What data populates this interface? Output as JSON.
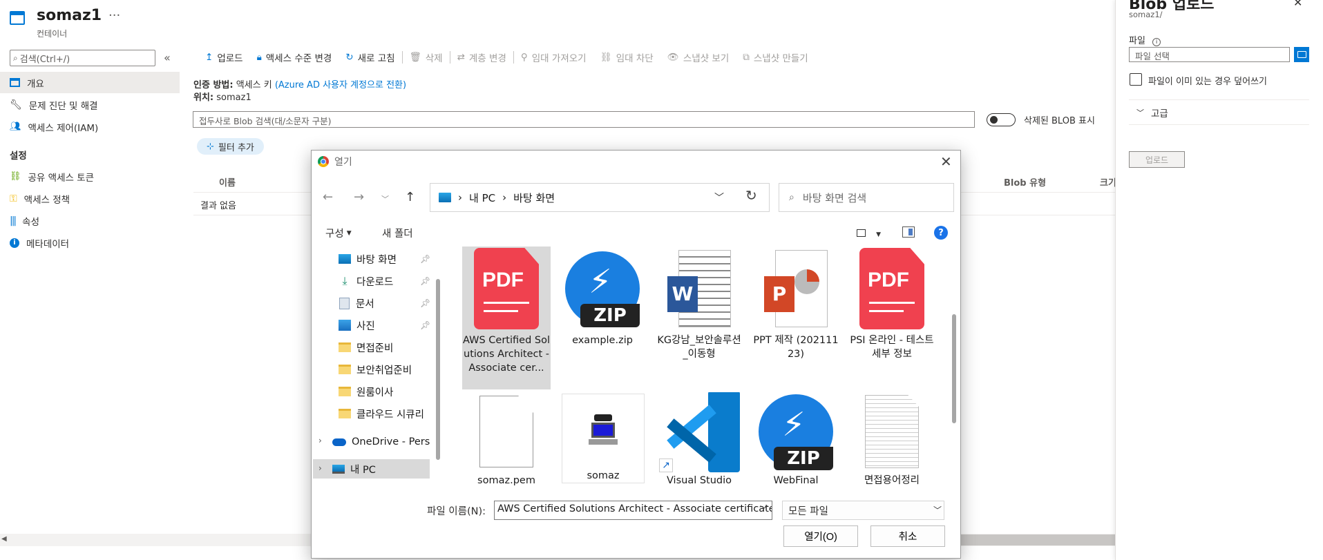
{
  "header": {
    "title": "somaz1",
    "more": "···",
    "subtitle": "컨테이너"
  },
  "sidebar": {
    "search_placeholder": "검색(Ctrl+/)",
    "collapse": "«",
    "items": [
      {
        "label": "개요",
        "icon": "overview-icon"
      },
      {
        "label": "문제 진단 및 해결",
        "icon": "wrench-icon"
      },
      {
        "label": "액세스 제어(IAM)",
        "icon": "people-icon"
      }
    ],
    "section_settings": "설정",
    "settings_items": [
      {
        "label": "공유 액세스 토큰",
        "icon": "link-icon"
      },
      {
        "label": "액세스 정책",
        "icon": "key-icon"
      },
      {
        "label": "속성",
        "icon": "properties-icon"
      },
      {
        "label": "메타데이터",
        "icon": "info-icon"
      }
    ]
  },
  "toolbar": {
    "upload": "업로드",
    "access_level": "액세스 수준 변경",
    "refresh": "새로 고침",
    "delete": "삭제",
    "change_tier": "계층 변경",
    "acquire_lease": "임대 가져오기",
    "break_lease": "임대 차단",
    "view_snapshots": "스냅샷 보기",
    "create_snapshot": "스냅샷 만들기"
  },
  "main": {
    "auth_label": "인증 방법:",
    "auth_value": "액세스 키",
    "auth_link": "(Azure AD 사용자 계정으로 전환)",
    "location_label": "위치:",
    "location_value": "somaz1",
    "blob_search_placeholder": "접두사로 Blob 검색(대/소문자 구분)",
    "show_deleted": "삭제된 BLOB 표시",
    "add_filter": "필터 추가",
    "col_name": "이름",
    "col_blob_type": "Blob 유형",
    "col_size": "크기",
    "no_results": "결과 없음"
  },
  "blade": {
    "title": "Blob 업로드",
    "subtitle": "somaz1/",
    "file_label": "파일",
    "file_placeholder": "파일 선택",
    "overwrite": "파일이 이미 있는 경우 덮어쓰기",
    "advanced": "고급",
    "upload_button": "업로드"
  },
  "dialog": {
    "title": "열기",
    "breadcrumb": [
      "내 PC",
      "바탕 화면"
    ],
    "search_placeholder": "바탕 화면 검색",
    "organize": "구성",
    "new_folder": "새 폴더",
    "tree": [
      {
        "label": "바탕 화면",
        "icon": "desktop-folder-icon",
        "pinned": true
      },
      {
        "label": "다운로드",
        "icon": "download-folder-icon",
        "pinned": true
      },
      {
        "label": "문서",
        "icon": "documents-folder-icon",
        "pinned": true
      },
      {
        "label": "사진",
        "icon": "pictures-folder-icon",
        "pinned": true
      },
      {
        "label": "면접준비",
        "icon": "folder-icon",
        "pinned": false
      },
      {
        "label": "보안취업준비",
        "icon": "folder-icon",
        "pinned": false
      },
      {
        "label": "원룸이사",
        "icon": "folder-icon",
        "pinned": false
      },
      {
        "label": "클라우드 시큐리",
        "icon": "folder-icon",
        "pinned": false
      },
      {
        "label": "OneDrive - Perso",
        "icon": "onedrive-icon",
        "pinned": false
      },
      {
        "label": "내 PC",
        "icon": "pc-icon",
        "pinned": false
      }
    ],
    "files": [
      {
        "label": "AWS Certified Solutions Architect - Associate cer...",
        "type": "pdf-icon"
      },
      {
        "label": "example.zip",
        "type": "zip-icon"
      },
      {
        "label": "KG강남_보안솔루션_이동형",
        "type": "word-icon"
      },
      {
        "label": "PPT 제작 (20211123)",
        "type": "powerpoint-icon"
      },
      {
        "label": "PSI 온라인 - 테스트 세부 정보",
        "type": "pdf-icon"
      },
      {
        "label": "somaz.pem",
        "type": "blank-file-icon"
      },
      {
        "label": "somaz",
        "type": "putty-icon"
      },
      {
        "label": "Visual Studio",
        "type": "vscode-icon"
      },
      {
        "label": "WebFinal",
        "type": "zip-icon"
      },
      {
        "label": "면접용어정리",
        "type": "text-file-icon"
      }
    ],
    "filename_label": "파일 이름(N):",
    "filename_value": "AWS Certified Solutions Architect - Associate certificate",
    "filetype_value": "모든 파일",
    "open_button": "열기(O)",
    "cancel_button": "취소",
    "pdf_text": "PDF",
    "zip_text": "ZIP",
    "word_letter": "W",
    "ppt_letter": "P"
  },
  "colors": {
    "azure_blue": "#0078d4",
    "pdf_red": "#f0414f",
    "zip_blue": "#1a7fe0",
    "word_blue": "#2b579a",
    "ppt_orange": "#d24726",
    "vscode_blue": "#0a7ccc"
  }
}
